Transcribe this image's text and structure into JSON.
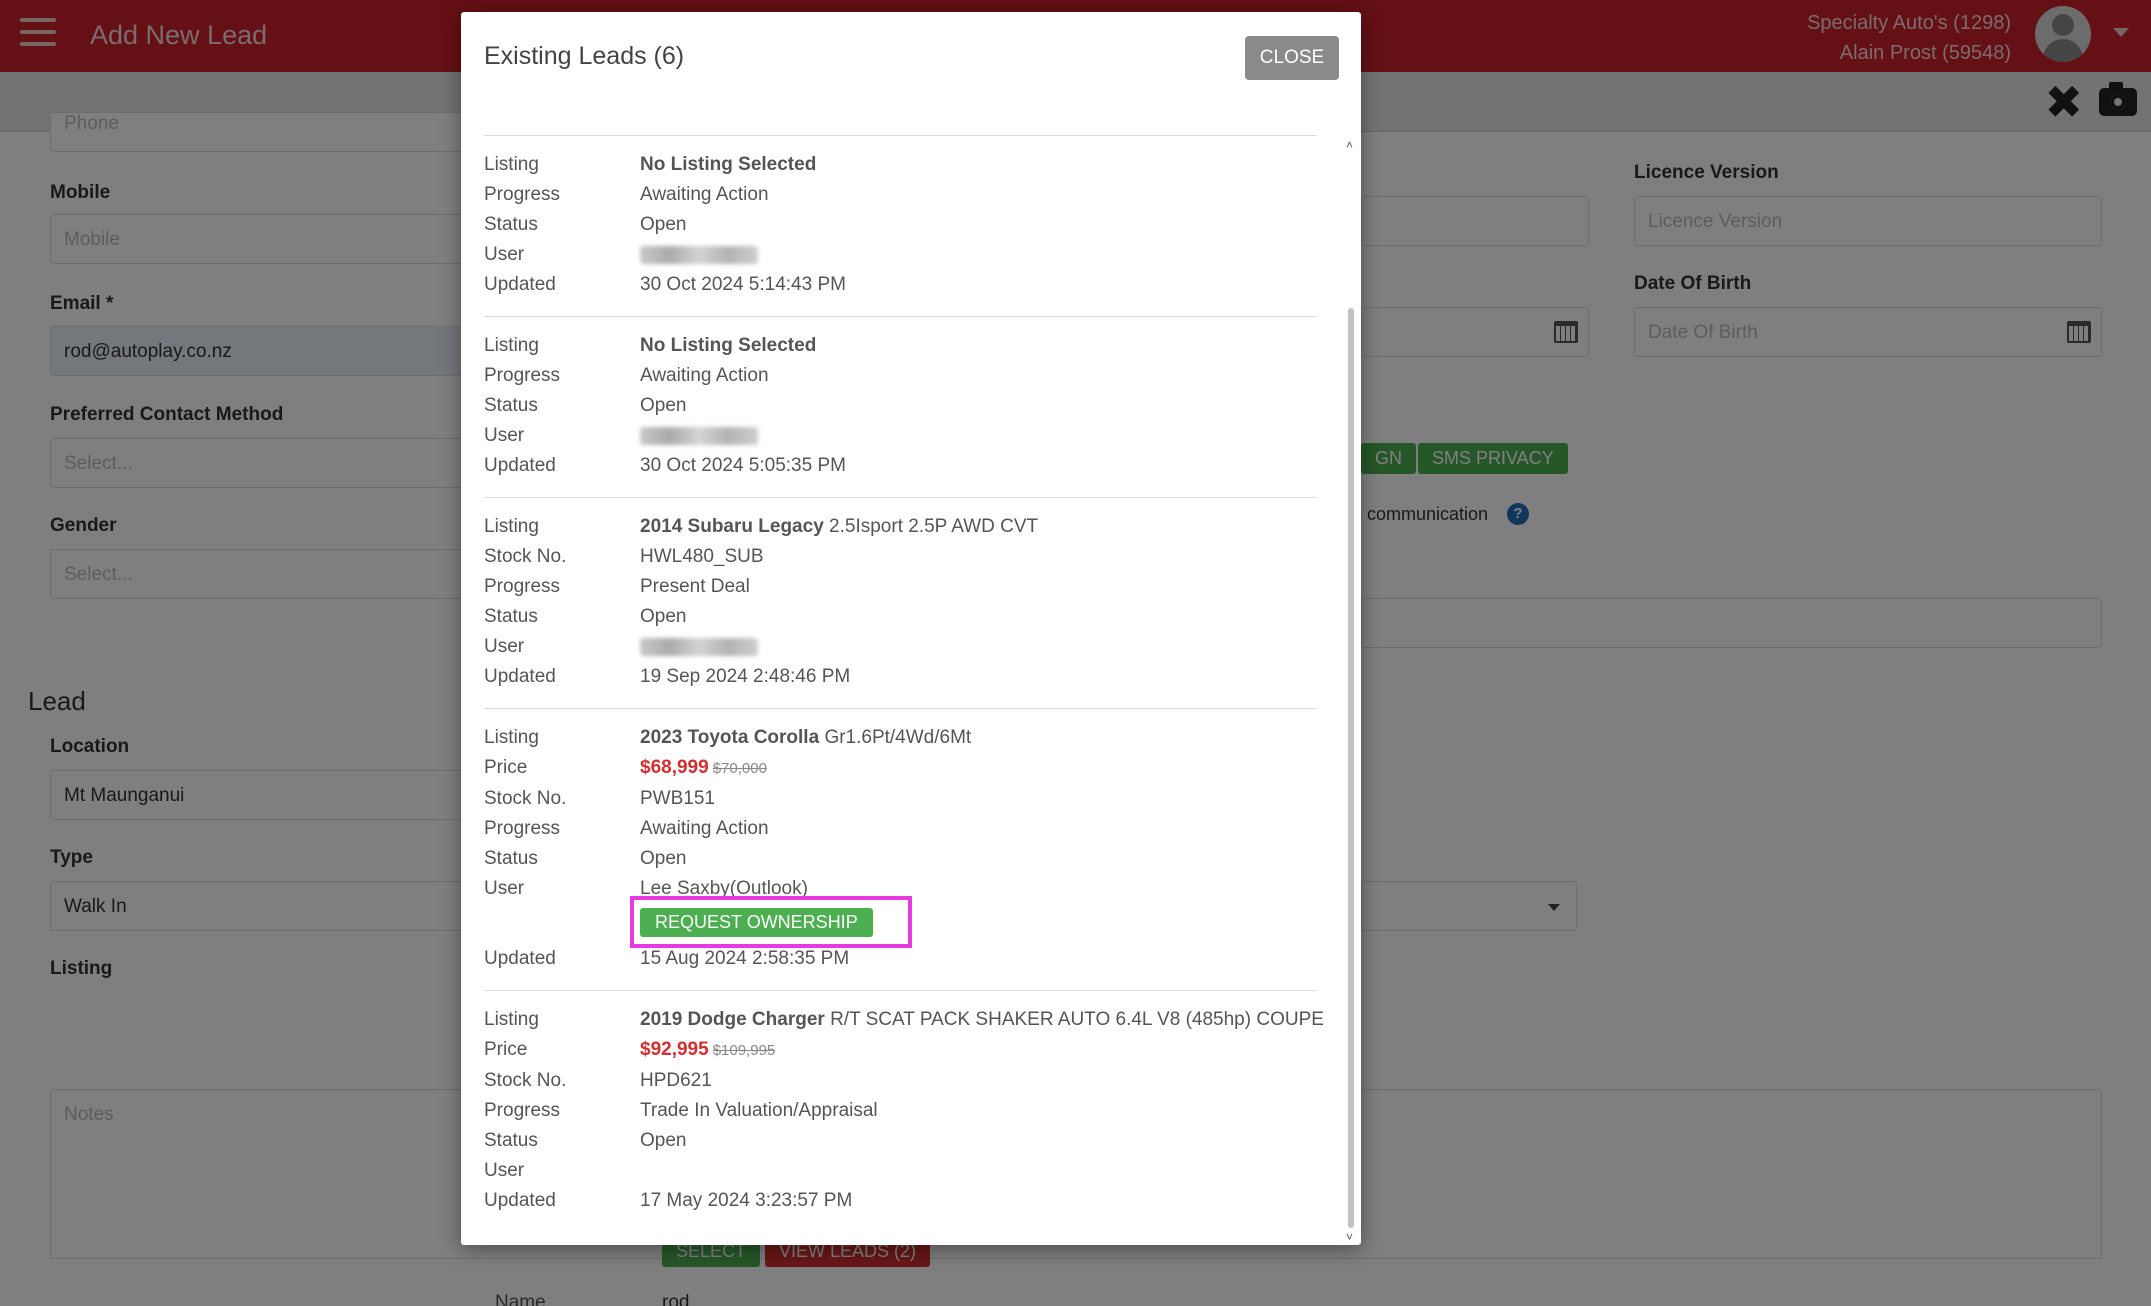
{
  "header": {
    "title": "Add New Lead",
    "dealer": "Specialty Auto's (1298)",
    "user": "Alain Prost (59548)"
  },
  "form": {
    "phone_placeholder": "Phone",
    "mobile_label": "Mobile",
    "mobile_placeholder": "Mobile",
    "email_label": "Email *",
    "email_value": "rod@autoplay.co.nz",
    "contact_label": "Preferred Contact Method",
    "contact_placeholder": "Select...",
    "gender_label": "Gender",
    "gender_placeholder": "Select...",
    "licence_version_label": "Licence Version",
    "licence_version_placeholder": "Licence Version",
    "dob_label": "Date Of Birth",
    "dob_placeholder": "Date Of Birth",
    "sign_btn_partial": "GN",
    "sms_privacy_btn": "SMS PRIVACY",
    "communication_text": "communication",
    "lead_section": "Lead",
    "location_label": "Location",
    "location_value": "Mt Maunganui",
    "type_label": "Type",
    "type_value": "Walk In",
    "listing_label": "Listing",
    "notes_placeholder": "Notes",
    "select_btn": "SELECT",
    "view_leads_btn": "VIEW LEADS (2)",
    "name_label": "Name",
    "name_value": "rod"
  },
  "modal": {
    "title": "Existing Leads (6)",
    "close_label": "CLOSE",
    "request_ownership_label": "REQUEST OWNERSHIP",
    "field_labels": {
      "listing": "Listing",
      "price": "Price",
      "stock": "Stock No.",
      "progress": "Progress",
      "status": "Status",
      "user": "User",
      "updated": "Updated"
    },
    "leads": [
      {
        "listing_bold": "No Listing Selected",
        "listing_rest": "",
        "progress": "Awaiting Action",
        "status": "Open",
        "updated": "30 Oct 2024 5:14:43 PM"
      },
      {
        "listing_bold": "No Listing Selected",
        "listing_rest": "",
        "progress": "Awaiting Action",
        "status": "Open",
        "updated": "30 Oct 2024 5:05:35 PM"
      },
      {
        "listing_bold": "2014 Subaru Legacy",
        "listing_rest": "2.5Isport 2.5P AWD CVT",
        "stock": "HWL480_SUB",
        "progress": "Present Deal",
        "status": "Open",
        "updated": "19 Sep 2024 2:48:46 PM"
      },
      {
        "listing_bold": "2023 Toyota Corolla",
        "listing_rest": "Gr1.6Pt/4Wd/6Mt",
        "price_now": "$68,999",
        "price_was": "$70,000",
        "stock": "PWB151",
        "progress": "Awaiting Action",
        "status": "Open",
        "user": "Lee Saxby(Outlook)",
        "updated": "15 Aug 2024 2:58:35 PM"
      },
      {
        "listing_bold": "2019 Dodge Charger",
        "listing_rest": "R/T SCAT PACK SHAKER AUTO 6.4L V8 (485hp) COUPE",
        "price_now": "$92,995",
        "price_was": "$109,995",
        "stock": "HPD621",
        "progress": "Trade In Valuation/Appraisal",
        "status": "Open",
        "user": "",
        "updated": "17 May 2024 3:23:57 PM"
      }
    ]
  },
  "colors": {
    "brand_red": "#c8202a",
    "green": "#4caf50",
    "price_red": "#d32f2f",
    "highlight": "#e63be3"
  }
}
